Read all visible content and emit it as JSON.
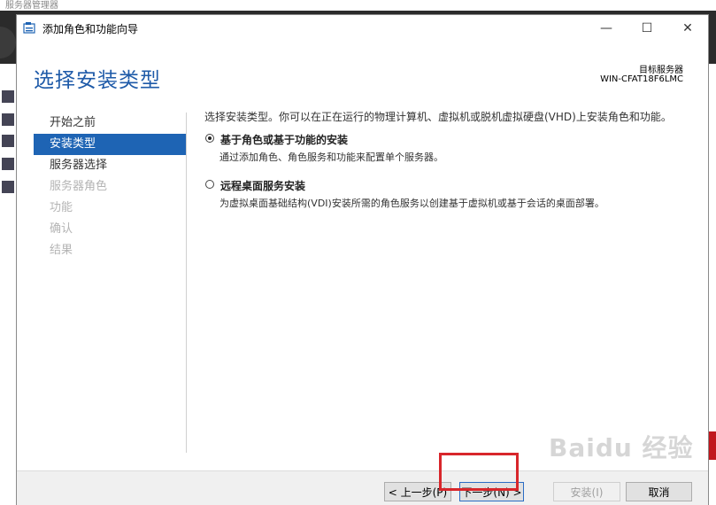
{
  "background": {
    "app_title": "服务器管理器"
  },
  "window": {
    "title": "添加角色和功能向导",
    "minimize": "—",
    "maximize": "☐",
    "close": "✕"
  },
  "page": {
    "title": "选择安装类型",
    "destination_label": "目标服务器",
    "destination_server": "WIN-CFAT18F6LMC"
  },
  "nav": {
    "items": [
      {
        "label": "开始之前",
        "state": "normal"
      },
      {
        "label": "安装类型",
        "state": "active"
      },
      {
        "label": "服务器选择",
        "state": "normal"
      },
      {
        "label": "服务器角色",
        "state": "disabled"
      },
      {
        "label": "功能",
        "state": "disabled"
      },
      {
        "label": "确认",
        "state": "disabled"
      },
      {
        "label": "结果",
        "state": "disabled"
      }
    ]
  },
  "content": {
    "description": "选择安装类型。你可以在正在运行的物理计算机、虚拟机或脱机虚拟硬盘(VHD)上安装角色和功能。",
    "options": [
      {
        "title": "基于角色或基于功能的安装",
        "desc": "通过添加角色、角色服务和功能来配置单个服务器。",
        "checked": true
      },
      {
        "title": "远程桌面服务安装",
        "desc": "为虚拟桌面基础结构(VDI)安装所需的角色服务以创建基于虚拟机或基于会话的桌面部署。",
        "checked": false
      }
    ]
  },
  "footer": {
    "prev": "< 上一步(P)",
    "next": "下一步(N) >",
    "install": "安装(I)",
    "cancel": "取消"
  },
  "watermark": "Baidu 经验",
  "colors": {
    "accent": "#1e64b4",
    "title": "#1e5aa8",
    "highlight": "#d8262b"
  }
}
